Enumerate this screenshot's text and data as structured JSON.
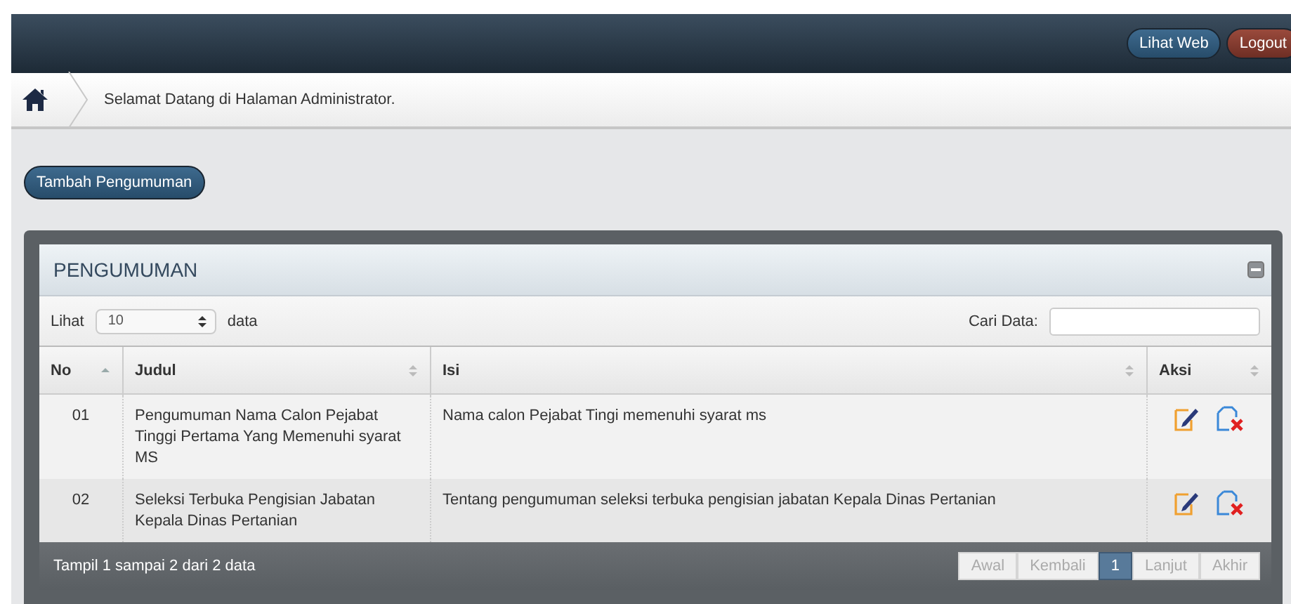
{
  "topbar": {
    "buttons": [
      {
        "label": "Lihat Web",
        "kind": "primary"
      },
      {
        "label": "Logout",
        "kind": "danger"
      }
    ]
  },
  "breadcrumb": {
    "text": "Selamat Datang di Halaman Administrator."
  },
  "add_button": {
    "label": "Tambah Pengumuman"
  },
  "panel": {
    "title": "PENGUMUMAN",
    "length": {
      "label": "Lihat",
      "value": "10",
      "suffix": "data"
    },
    "search": {
      "label": "Cari Data:"
    },
    "columns": [
      {
        "label": "No",
        "sorted": true
      },
      {
        "label": "Judul",
        "sorted": false
      },
      {
        "label": "Isi",
        "sorted": false
      },
      {
        "label": "Aksi",
        "sorted": false
      }
    ],
    "rows": [
      {
        "no": "01",
        "judul": "Pengumuman Nama Calon Pejabat Tinggi Pertama Yang Memenuhi syarat MS",
        "isi": "Nama calon Pejabat Tingi memenuhi syarat ms"
      },
      {
        "no": "02",
        "judul": "Seleksi Terbuka Pengisian Jabatan Kepala Dinas Pertanian",
        "isi": "Tentang pengumuman seleksi terbuka pengisian jabatan Kepala Dinas Pertanian"
      }
    ],
    "info": "Tampil 1 sampai 2 dari 2 data",
    "pages": [
      {
        "label": "Awal",
        "selected": false,
        "disabled": true
      },
      {
        "label": "Kembali",
        "selected": false,
        "disabled": true
      },
      {
        "label": "1",
        "selected": true,
        "disabled": false
      },
      {
        "label": "Lanjut",
        "selected": false,
        "disabled": true
      },
      {
        "label": "Akhir",
        "selected": false,
        "disabled": true
      }
    ]
  }
}
